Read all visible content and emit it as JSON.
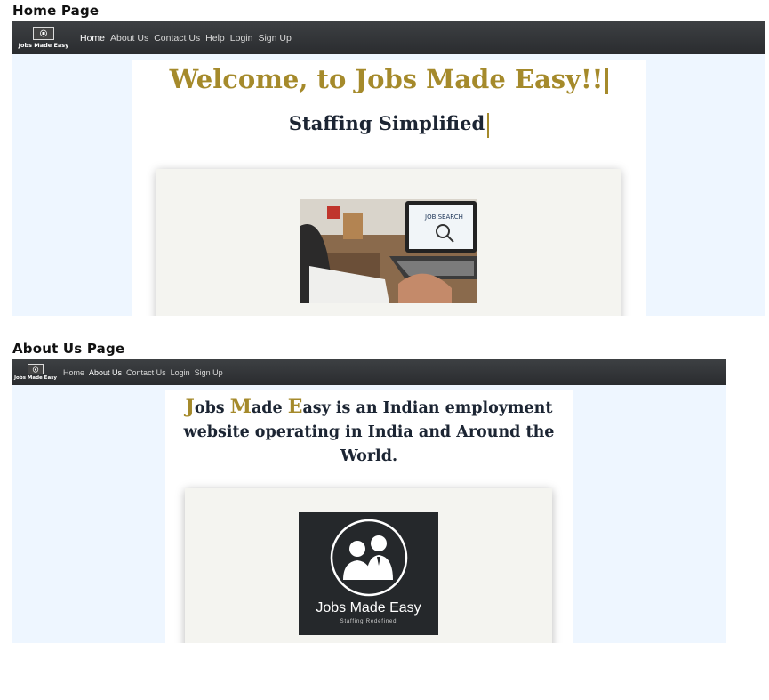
{
  "home": {
    "section_title": "Home Page",
    "brand": "Jobs Made Easy",
    "nav": [
      {
        "label": "Home",
        "active": true
      },
      {
        "label": "About Us",
        "active": false
      },
      {
        "label": "Contact Us",
        "active": false
      },
      {
        "label": "Help",
        "active": false
      },
      {
        "label": "Login",
        "active": false
      },
      {
        "label": "Sign Up",
        "active": false
      }
    ],
    "headline": "Welcome, to Jobs Made Easy!!",
    "tagline": "Staffing Simplified",
    "image_screen_text": "JOB SEARCH"
  },
  "about": {
    "section_title": "About Us Page",
    "brand": "Jobs Made Easy",
    "nav": [
      {
        "label": "Home",
        "active": false
      },
      {
        "label": "About Us",
        "active": true
      },
      {
        "label": "Contact Us",
        "active": false
      },
      {
        "label": "Login",
        "active": false
      },
      {
        "label": "Sign Up",
        "active": false
      }
    ],
    "intro_initials": [
      "J",
      "M",
      "E"
    ],
    "intro_rest": [
      "obs ",
      "ade ",
      "asy"
    ],
    "intro_tail": " is an Indian employment website operating in India and Around the World.",
    "logo_title": "Jobs Made Easy",
    "logo_subtitle": "Staffing Redefined"
  },
  "colors": {
    "accent_gold": "#a58a2b",
    "navbar": "#2f3134",
    "page_bg": "#eef6ff",
    "card_bg": "#f4f4f0"
  }
}
